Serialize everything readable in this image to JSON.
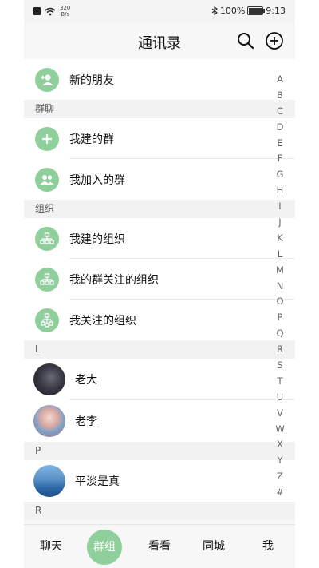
{
  "status_bar": {
    "net_speed_value": "320",
    "net_speed_unit": "B/s",
    "battery": "100%",
    "time": "9:13",
    "battery_level": 1.0
  },
  "header": {
    "title": "通讯录",
    "search_icon": "search-icon",
    "add_icon": "plus-circle-icon"
  },
  "top_item": {
    "label": "新的朋友",
    "icon": "add-person-icon"
  },
  "sections": {
    "group_chat": "群聊",
    "organization": "组织",
    "l": "L",
    "p": "P",
    "r": "R"
  },
  "group_items": [
    {
      "label": "我建的群",
      "icon": "plus-icon"
    },
    {
      "label": "我加入的群",
      "icon": "group-people-icon"
    }
  ],
  "org_items": [
    {
      "label": "我建的组织",
      "icon": "org-chart-icon"
    },
    {
      "label": "我的群关注的组织",
      "icon": "org-chart-icon"
    },
    {
      "label": "我关注的组织",
      "icon": "org-chart-icon"
    }
  ],
  "contacts_l": [
    {
      "name": "老大"
    },
    {
      "name": "老李"
    }
  ],
  "contacts_p": [
    {
      "name": "平淡是真"
    }
  ],
  "alphabet_index": [
    "A",
    "B",
    "C",
    "D",
    "E",
    "F",
    "G",
    "H",
    "I",
    "J",
    "K",
    "L",
    "M",
    "N",
    "O",
    "P",
    "Q",
    "R",
    "S",
    "T",
    "U",
    "V",
    "W",
    "X",
    "Y",
    "Z",
    "#"
  ],
  "tabs": [
    "聊天",
    "群组",
    "看看",
    "同城",
    "我"
  ],
  "active_tab": "群组",
  "colors": {
    "accent": "#8fcf9b",
    "section_bg": "#f2f2f2",
    "background": "#f7f7f7"
  }
}
